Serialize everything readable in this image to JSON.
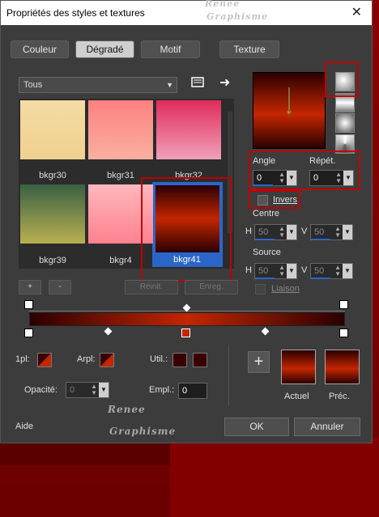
{
  "window": {
    "title": "Propriétés des styles et textures",
    "close": "✕"
  },
  "watermark": {
    "line1": "Renee",
    "line2": "Graphisme"
  },
  "tabs": [
    {
      "label": "Couleur",
      "active": false
    },
    {
      "label": "Dégradé",
      "active": true
    },
    {
      "label": "Motif",
      "active": false
    },
    {
      "label": "Texture",
      "active": false
    }
  ],
  "category": {
    "value": "Tous"
  },
  "swatches": [
    {
      "name": "bkgr30"
    },
    {
      "name": "bkgr31"
    },
    {
      "name": "bkgr32"
    },
    {
      "name": "bkgr39"
    },
    {
      "name": "bkgr4"
    },
    {
      "name": "bkgr41",
      "selected": true
    }
  ],
  "list_buttons": {
    "add": "+",
    "remove": "-",
    "reset": "Réinit.",
    "save": "Enreg."
  },
  "angle": {
    "label": "Angle",
    "value": "0"
  },
  "repeat": {
    "label": "Répét.",
    "value": "0"
  },
  "invert": {
    "label": "Invers",
    "checked": false
  },
  "center": {
    "label": "Centre",
    "h_label": "H",
    "h": "50",
    "v_label": "V",
    "v": "50"
  },
  "source": {
    "label": "Source",
    "h_label": "H",
    "h": "50",
    "v_label": "V",
    "v": "50"
  },
  "link": {
    "label": "Liaison",
    "checked": false
  },
  "editor": {
    "first_label": "1pl:",
    "back_label": "Arpl:",
    "user_label": "Util.:",
    "opacity_label": "Opacité:",
    "opacity_value": "0",
    "location_label": "Empl.:",
    "location_value": "0",
    "add_symbol": "+",
    "current_label": "Actuel",
    "previous_label": "Préc."
  },
  "footer": {
    "help": "Aide",
    "ok": "OK",
    "cancel": "Annuler"
  },
  "colors": {
    "gradient_dark": "#2a0000",
    "gradient_light": "#c42600",
    "highlight": "#c00000",
    "selection": "#2a66c8"
  }
}
